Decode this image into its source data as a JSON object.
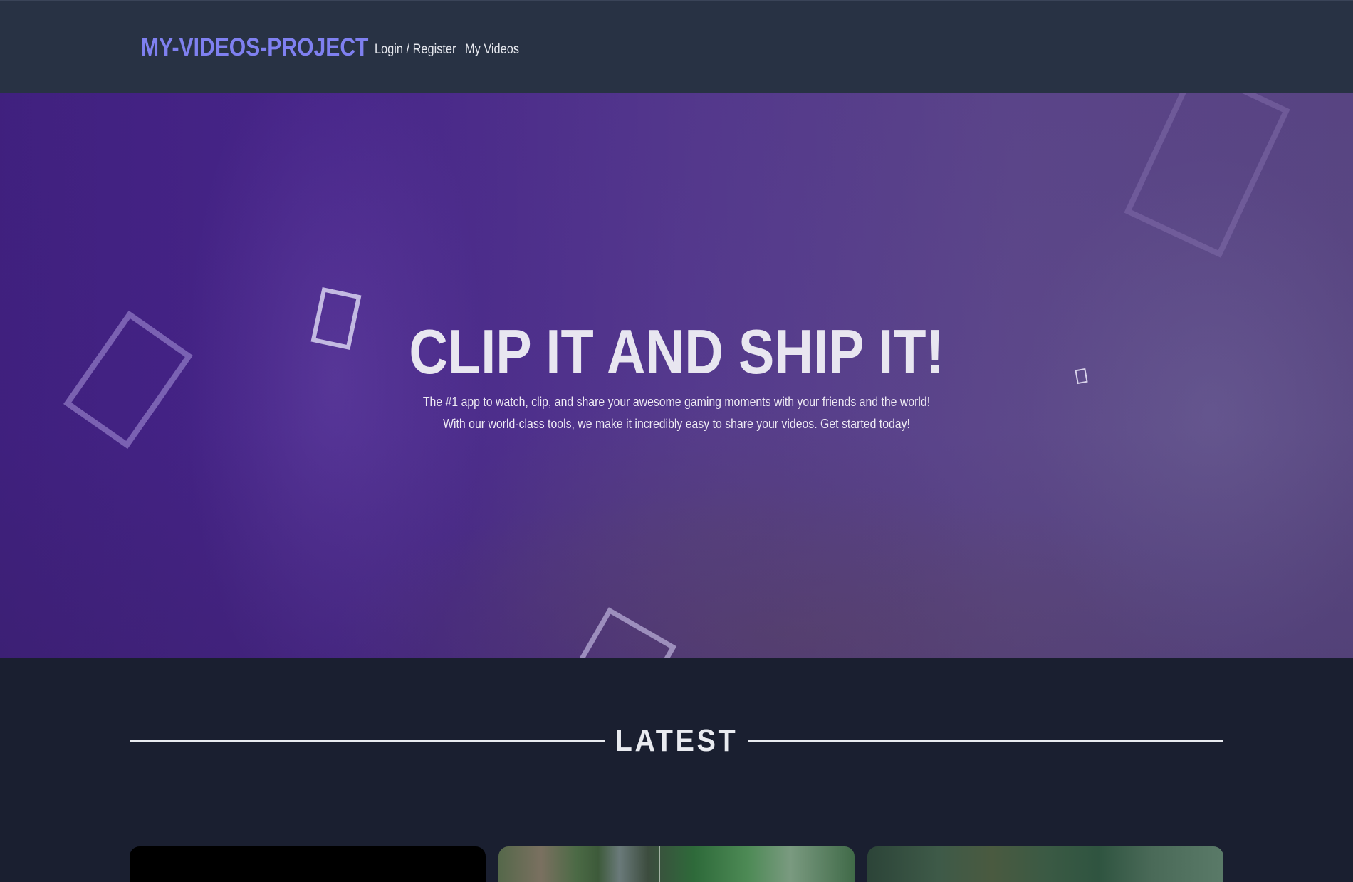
{
  "navbar": {
    "brand": "MY-VIDEOS-PROJECT",
    "links": [
      {
        "label": "Login / Register"
      },
      {
        "label": "My Videos"
      }
    ]
  },
  "hero": {
    "title": "CLIP IT AND SHIP IT!",
    "description": "The #1 app to watch, clip, and share your awesome gaming moments with your friends and the world! With our world-class tools, we make it incredibly easy to share your videos. Get started today!"
  },
  "latest": {
    "heading": "LATEST"
  },
  "colors": {
    "brand": "#7f80f0",
    "navbar_bg": "#283244",
    "page_bg": "#1a1f30",
    "hero_purple": "#47258a"
  }
}
